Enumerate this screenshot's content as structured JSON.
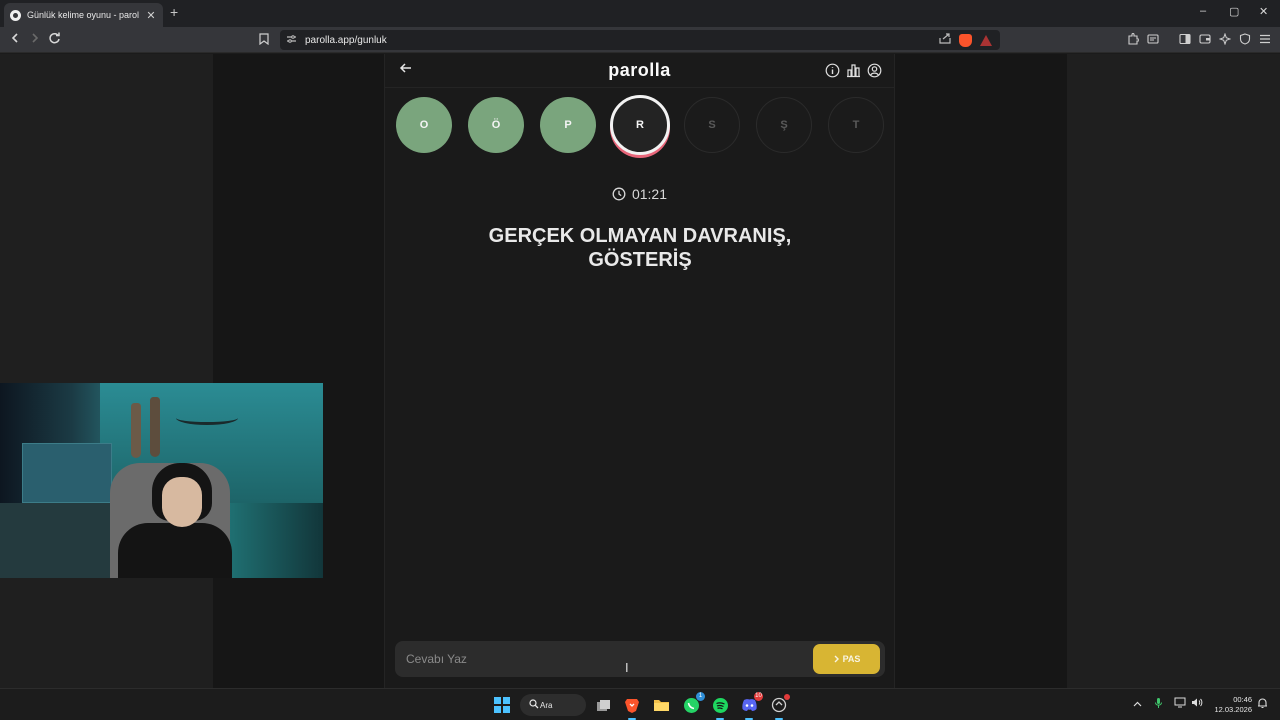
{
  "browser": {
    "tab_title": "Günlük kelime oyunu - parolla -",
    "tab_close": "✕",
    "new_tab": "+",
    "url": "parolla.app/gunluk",
    "window_controls": {
      "minimize": "–",
      "maximize": "▢",
      "close": "✕"
    }
  },
  "app": {
    "brand": "parolla",
    "letters": [
      {
        "char": "O",
        "state": "done"
      },
      {
        "char": "Ö",
        "state": "done"
      },
      {
        "char": "P",
        "state": "done"
      },
      {
        "char": "R",
        "state": "active"
      },
      {
        "char": "S",
        "state": "pending"
      },
      {
        "char": "Ş",
        "state": "pending"
      },
      {
        "char": "T",
        "state": "pending"
      }
    ],
    "timer": "01:21",
    "question_line1": "GERÇEK OLMAYAN DAVRANIŞ,",
    "question_line2": "GÖSTERİŞ",
    "answer_placeholder": "Cevabı Yaz",
    "pass_label": "PAS",
    "colors": {
      "done": "#7aa57d",
      "active_ring": "#e8667a",
      "pass_button": "#d8b533"
    }
  },
  "taskbar": {
    "search_label": "Ara",
    "whatsapp_badge": "1",
    "discord_badge": "10",
    "clock_time": "00:46",
    "clock_date": "12.03.2026"
  }
}
